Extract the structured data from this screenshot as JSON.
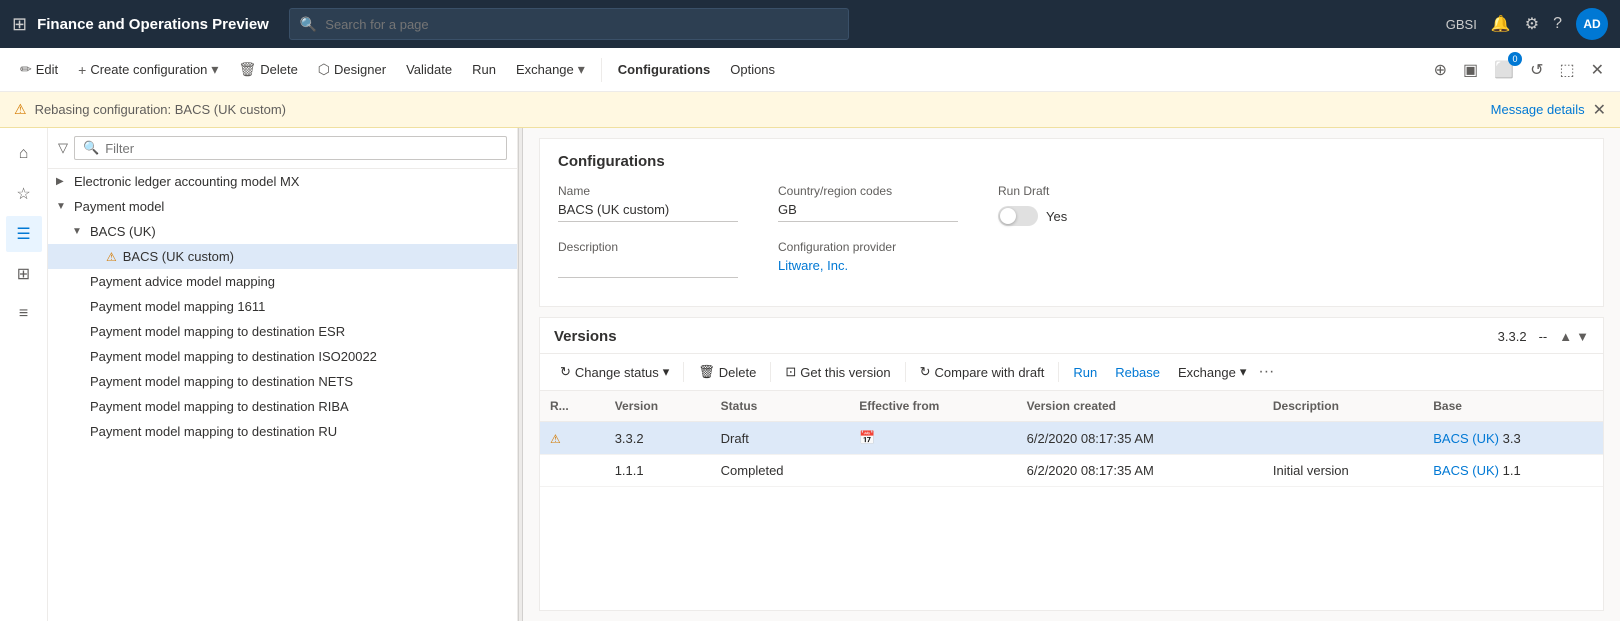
{
  "app": {
    "title": "Finance and Operations Preview",
    "user": "GBSI",
    "avatar": "AD"
  },
  "search": {
    "placeholder": "Search for a page"
  },
  "commandBar": {
    "edit": "Edit",
    "createConfiguration": "Create configuration",
    "delete": "Delete",
    "designer": "Designer",
    "validate": "Validate",
    "run": "Run",
    "exchange": "Exchange",
    "configurations": "Configurations",
    "options": "Options"
  },
  "alert": {
    "message": "Rebasing configuration: BACS (UK custom)",
    "linkText": "Message details"
  },
  "treePanel": {
    "filterPlaceholder": "Filter",
    "items": [
      {
        "level": 0,
        "text": "Electronic ledger accounting model MX",
        "hasChildren": true,
        "expanded": false,
        "warn": false,
        "selected": false
      },
      {
        "level": 0,
        "text": "Payment model",
        "hasChildren": true,
        "expanded": true,
        "warn": false,
        "selected": false
      },
      {
        "level": 1,
        "text": "BACS (UK)",
        "hasChildren": true,
        "expanded": true,
        "warn": false,
        "selected": false
      },
      {
        "level": 2,
        "text": "BACS (UK custom)",
        "hasChildren": false,
        "expanded": false,
        "warn": true,
        "selected": true
      },
      {
        "level": 1,
        "text": "Payment advice model mapping",
        "hasChildren": false,
        "expanded": false,
        "warn": false,
        "selected": false
      },
      {
        "level": 1,
        "text": "Payment model mapping 1611",
        "hasChildren": false,
        "expanded": false,
        "warn": false,
        "selected": false
      },
      {
        "level": 1,
        "text": "Payment model mapping to destination ESR",
        "hasChildren": false,
        "expanded": false,
        "warn": false,
        "selected": false
      },
      {
        "level": 1,
        "text": "Payment model mapping to destination ISO20022",
        "hasChildren": false,
        "expanded": false,
        "warn": false,
        "selected": false
      },
      {
        "level": 1,
        "text": "Payment model mapping to destination NETS",
        "hasChildren": false,
        "expanded": false,
        "warn": false,
        "selected": false
      },
      {
        "level": 1,
        "text": "Payment model mapping to destination RIBA",
        "hasChildren": false,
        "expanded": false,
        "warn": false,
        "selected": false
      },
      {
        "level": 1,
        "text": "Payment model mapping to destination RU",
        "hasChildren": false,
        "expanded": false,
        "warn": false,
        "selected": false
      }
    ]
  },
  "configurations": {
    "sectionTitle": "Configurations",
    "nameLabel": "Name",
    "nameValue": "BACS (UK custom)",
    "countryLabel": "Country/region codes",
    "countryValue": "GB",
    "runDraftLabel": "Run Draft",
    "runDraftValue": "Yes",
    "descriptionLabel": "Description",
    "providerLabel": "Configuration provider",
    "providerValue": "Litware, Inc."
  },
  "versions": {
    "sectionTitle": "Versions",
    "currentVersion": "3.3.2",
    "dash": "--",
    "commands": {
      "changeStatus": "Change status",
      "delete": "Delete",
      "getThisVersion": "Get this version",
      "compareWithDraft": "Compare with draft",
      "run": "Run",
      "rebase": "Rebase",
      "exchange": "Exchange"
    },
    "table": {
      "columns": [
        "R...",
        "Version",
        "Status",
        "Effective from",
        "Version created",
        "Description",
        "Base"
      ],
      "rows": [
        {
          "warn": true,
          "version": "3.3.2",
          "status": "Draft",
          "effectiveFrom": "",
          "hasCalendar": true,
          "versionCreated": "6/2/2020 08:17:35 AM",
          "description": "",
          "base": "BACS (UK)",
          "baseVersion": "3.3",
          "selected": true
        },
        {
          "warn": false,
          "version": "1.1.1",
          "status": "Completed",
          "effectiveFrom": "",
          "hasCalendar": false,
          "versionCreated": "6/2/2020 08:17:35 AM",
          "description": "Initial version",
          "base": "BACS (UK)",
          "baseVersion": "1.1",
          "selected": false
        }
      ]
    }
  }
}
